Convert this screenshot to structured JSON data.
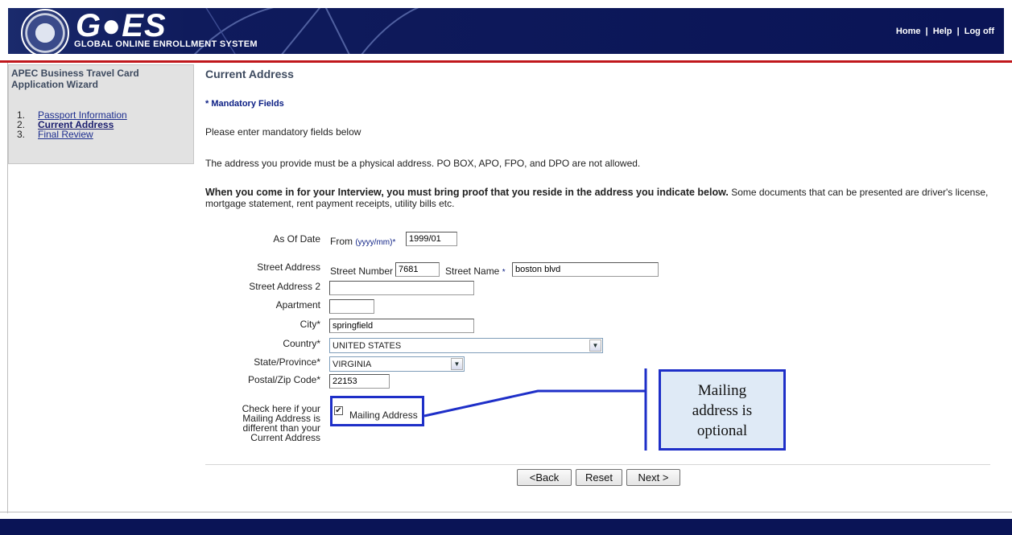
{
  "header": {
    "logo_text": "G●ES",
    "logo_subtitle": "GLOBAL ONLINE ENROLLMENT SYSTEM",
    "links": [
      "Home",
      "Help",
      "Log off"
    ],
    "separator": "|"
  },
  "sidebar": {
    "title": "APEC Business Travel Card Application Wizard",
    "items": [
      {
        "num": "1.",
        "label": "Passport Information"
      },
      {
        "num": "2.",
        "label": "Current Address"
      },
      {
        "num": "3.",
        "label": "Final Review"
      }
    ]
  },
  "main": {
    "title": "Current Address",
    "mandatory_note": "* Mandatory Fields",
    "instruction": "Please enter mandatory fields below",
    "address_note": "The address you provide must be a physical address. PO BOX, APO, FPO, and DPO are not allowed.",
    "interview_bold": "When you come in for your Interview, you must bring proof that you reside in the address you indicate below.",
    "interview_rest": " Some documents that can be presented are driver's license, mortgage statement, rent payment receipts, utility bills etc."
  },
  "form": {
    "as_of_date": {
      "label": "As Of Date",
      "prefix": "From",
      "hint": "(yyyy/mm)",
      "star": "*",
      "value": "1999/01"
    },
    "street_address": {
      "label": "Street Address",
      "number_label": "Street Number",
      "number_value": "7681",
      "name_label": "Street Name",
      "name_star": "*",
      "name_value": "boston blvd"
    },
    "street_address_2": {
      "label": "Street Address 2",
      "value": ""
    },
    "apartment": {
      "label": "Apartment",
      "value": ""
    },
    "city": {
      "label": "City*",
      "value": "springfield"
    },
    "country": {
      "label": "Country*",
      "value": "UNITED STATES"
    },
    "state": {
      "label": "State/Province*",
      "value": "VIRGINIA"
    },
    "postal": {
      "label": "Postal/Zip Code*",
      "value": "22153"
    },
    "mailing": {
      "label_lines": [
        "Check here if your",
        "Mailing Address is",
        "different than your",
        "Current Address"
      ],
      "checkbox_label": "Mailing Address",
      "checked": true
    }
  },
  "callout": {
    "lines": [
      "Mailing",
      "address is",
      "optional"
    ]
  },
  "buttons": {
    "back": "<Back",
    "reset": "Reset",
    "next": "Next >"
  },
  "colors": {
    "banner": "#0a1456",
    "accent_red": "#c0171c",
    "callout_border": "#1e2fc8",
    "callout_fill": "#dfeaf6",
    "link": "#1c2d8e"
  }
}
